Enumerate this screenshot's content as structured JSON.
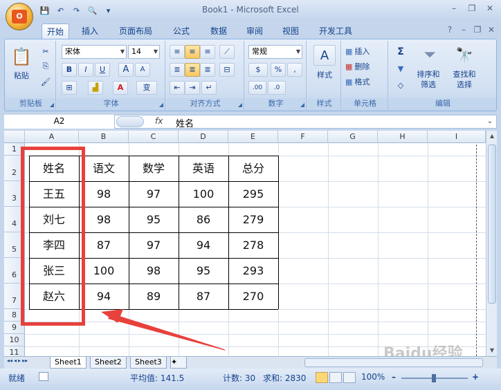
{
  "window": {
    "title": "Book1 - Microsoft Excel",
    "office_button": "O"
  },
  "qat": {
    "save": "💾",
    "undo": "↶",
    "redo": "↷",
    "preview": "🔍",
    "more": "▾"
  },
  "window_controls": {
    "minimize": "–",
    "restore": "❐",
    "close": "✕"
  },
  "tabs": [
    {
      "label": "开始",
      "active": true
    },
    {
      "label": "插入"
    },
    {
      "label": "页面布局"
    },
    {
      "label": "公式"
    },
    {
      "label": "数据"
    },
    {
      "label": "审阅"
    },
    {
      "label": "视图"
    },
    {
      "label": "开发工具"
    }
  ],
  "help_controls": {
    "help": "?",
    "minimize": "–",
    "restore": "❐",
    "close": "✕"
  },
  "ribbon": {
    "clipboard": {
      "label": "剪贴板",
      "paste": "粘贴",
      "cut_icon": "✂",
      "copy_icon": "⎘",
      "painter_icon": "🖌"
    },
    "font": {
      "label": "字体",
      "font_name": "宋体",
      "font_size": "14",
      "bold": "B",
      "italic": "I",
      "underline": "U",
      "grow": "A",
      "shrink": "A",
      "border_icon": "⊞",
      "fill_icon": "▟",
      "color_icon": "A",
      "phonetic": "变"
    },
    "alignment": {
      "label": "对齐方式"
    },
    "number": {
      "label": "数字",
      "format": "常规",
      "currency": "$",
      "percent": "%",
      "comma": ",",
      "inc_dec": ".00",
      "dec_dec": ".0"
    },
    "styles": {
      "label": "样式",
      "button": "样式"
    },
    "cells": {
      "label": "单元格",
      "insert": "插入",
      "delete": "删除",
      "format": "格式"
    },
    "editing": {
      "label": "编辑",
      "sum": "Σ",
      "sort": "排序和\n筛选",
      "find": "查找和\n选择"
    }
  },
  "formula_bar": {
    "name_box": "A2",
    "fx": "fx",
    "value": "姓名"
  },
  "columns": [
    "A",
    "B",
    "C",
    "D",
    "E",
    "F",
    "G",
    "H",
    "I"
  ],
  "rows": [
    "1",
    "2",
    "3",
    "4",
    "5",
    "6",
    "7",
    "8",
    "9",
    "10",
    "11"
  ],
  "table": {
    "header": [
      "姓名",
      "语文",
      "数学",
      "英语",
      "总分"
    ],
    "rows": [
      [
        "王五",
        "98",
        "97",
        "100",
        "295"
      ],
      [
        "刘七",
        "98",
        "95",
        "86",
        "279"
      ],
      [
        "李四",
        "87",
        "97",
        "94",
        "278"
      ],
      [
        "张三",
        "100",
        "98",
        "95",
        "293"
      ],
      [
        "赵六",
        "94",
        "89",
        "87",
        "270"
      ]
    ]
  },
  "sheet_tabs": [
    "Sheet1",
    "Sheet2",
    "Sheet3"
  ],
  "sheet_nav": [
    "◂◂",
    "◂",
    "▸",
    "▸▸"
  ],
  "status": {
    "mode": "就绪",
    "average": "平均值: 141.5",
    "count": "计数: 30",
    "sum": "求和: 2830",
    "zoom": "100%",
    "zoom_minus": "–",
    "zoom_plus": "+"
  },
  "colors": {
    "annotation": "#e8413c"
  }
}
